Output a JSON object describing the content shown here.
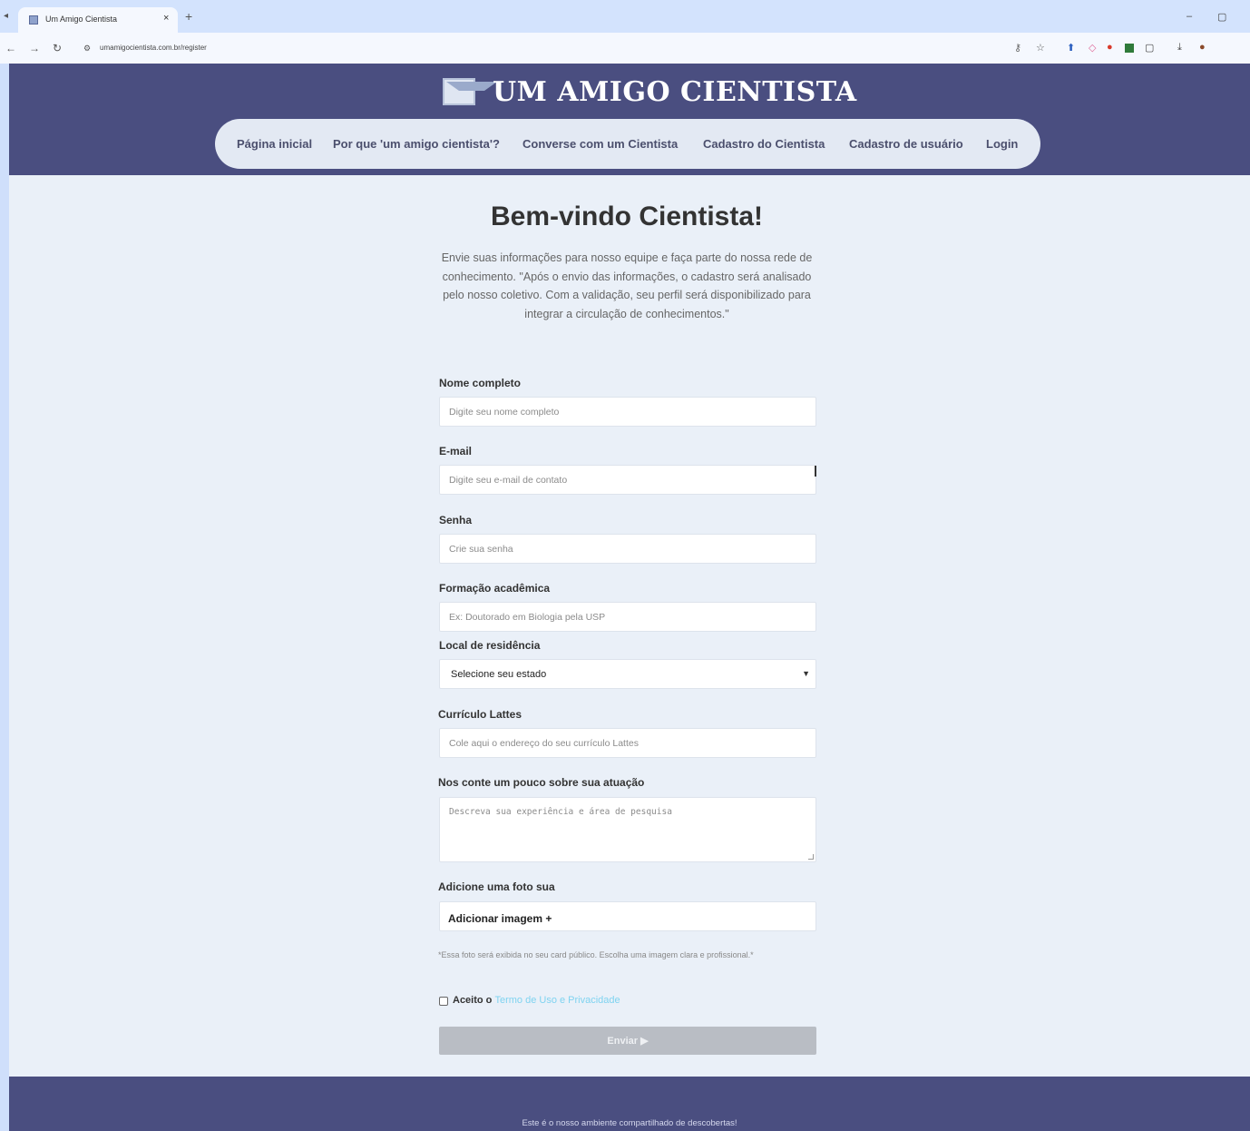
{
  "browser": {
    "tab_title": "Um Amigo Cientista",
    "tab_close": "×",
    "new_tab": "+",
    "url": "umamigocientista.com.br/register",
    "minimize": "–",
    "restore": "▢"
  },
  "header": {
    "brand": "UM AMIGO CIENTISTA",
    "nav": [
      "Página inicial",
      "Por que 'um amigo cientista'?",
      "Converse com um Cientista",
      "Cadastro do Cientista",
      "Cadastro de usuário",
      "Login"
    ]
  },
  "main": {
    "title": "Bem-vindo Cientista!",
    "intro": "Envie suas informações para nosso equipe e faça parte do nossa rede de conhecimento. \"Após o envio das informações, o cadastro será analisado pelo nosso coletivo. Com a validação, seu perfil será disponibilizado para integrar a circulação de conhecimentos.\""
  },
  "form": {
    "name_label": "Nome completo",
    "name_placeholder": "Digite seu nome completo",
    "email_label": "E-mail",
    "email_placeholder": "Digite seu e-mail de contato",
    "password_label": "Senha",
    "password_placeholder": "Crie sua senha",
    "education_label": "Formação acadêmica",
    "education_placeholder": "Ex: Doutorado em Biologia pela USP",
    "residence_label": "Local de residência",
    "residence_value": "Selecione seu estado",
    "lattes_label": "Currículo Lattes",
    "lattes_placeholder": "Cole aqui o endereço do seu currículo Lattes",
    "about_label": "Nos conte um pouco sobre sua atuação",
    "about_placeholder": "Descreva sua experiência e área de pesquisa",
    "photo_label": "Adicione uma foto sua",
    "photo_button": "Adicionar imagem +",
    "photo_note": "*Essa foto será exibida no seu card público. Escolha uma imagem clara e profissional.*",
    "accept_prefix": "Aceito o",
    "terms_link": "Termo de Uso e Privacidade",
    "submit": "Enviar ▶"
  },
  "footer": {
    "text": "Este é o nosso ambiente compartilhado de descobertas!"
  },
  "colors": {
    "header_bg": "#4a4e80",
    "page_bg": "#eaf0f8",
    "nav_pill": "#e3e9f3",
    "submit_disabled": "#b9bdc4",
    "terms_link": "#7fd3f0"
  }
}
